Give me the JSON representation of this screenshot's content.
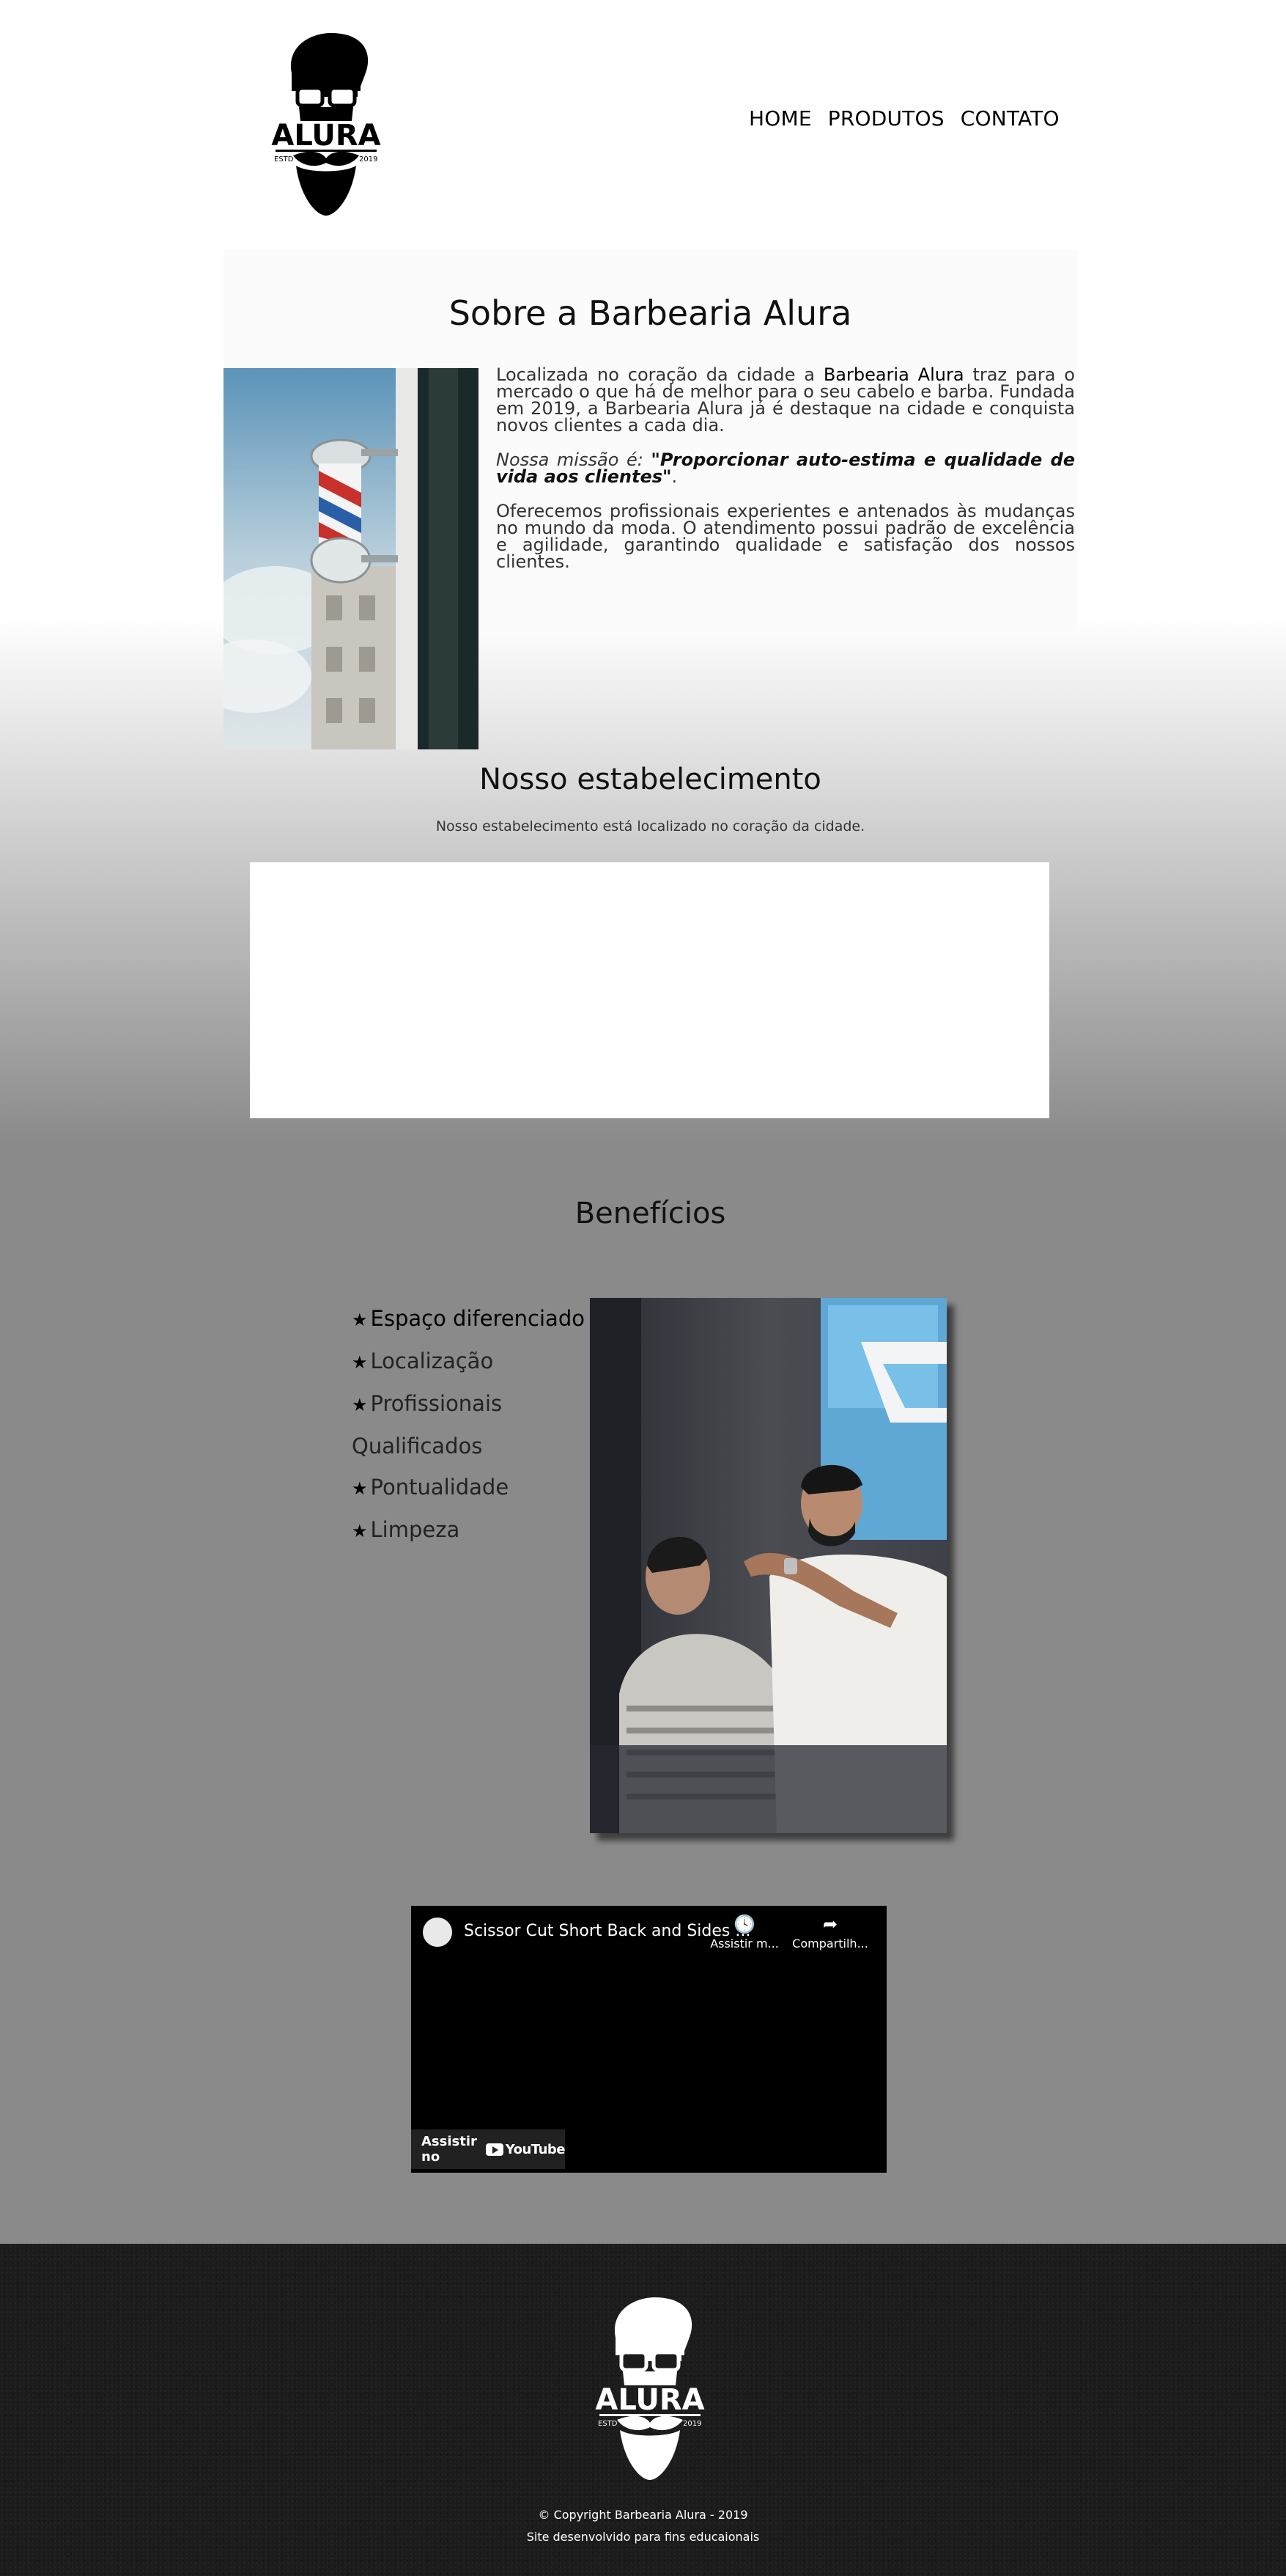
{
  "brand": {
    "name": "ALURA",
    "estd_left": "ESTD",
    "estd_right": "2019"
  },
  "nav": {
    "items": [
      "HOME",
      "PRODUTOS",
      "CONTATO"
    ]
  },
  "about": {
    "title": "Sobre a Barbearia Alura",
    "p1_before": "Localizada no coração da cidade a ",
    "p1_strong": "Barbearia Alura",
    "p1_after": " traz para o mercado o que há de melhor para o seu cabelo e barba. Fundada em 2019, a Barbearia Alura já é destaque na cidade e conquista novos clientes a cada dia.",
    "mission_label": "Nossa missão é: ",
    "mission_quote": "\"Proporcionar auto-estima e qualidade de vida aos clientes\"",
    "mission_end": ".",
    "p3": "Oferecemos profissionais experientes e antenados às mudanças no mundo da moda. O atendimento possui padrão de excelência e agilidade, garantindo qualidade e satisfação dos nossos clientes."
  },
  "establishment": {
    "title": "Nosso estabelecimento",
    "description": "Nosso estabelecimento está localizado no coração da cidade."
  },
  "benefits": {
    "title": "Benefícios",
    "items": [
      "Espaço diferenciado",
      "Localização",
      "Profissionais",
      "Qualificados",
      "Pontualidade",
      "Limpeza"
    ]
  },
  "video": {
    "title": "Scissor Cut Short Back and Sides ...",
    "watch_later": "Assistir m...",
    "share": "Compartilh...",
    "watch_on": "Assistir no",
    "youtube": "YouTube"
  },
  "footer": {
    "copyright": "© Copyright Barbearia Alura - 2019",
    "note": "Site desenvolvido para fins educaionais"
  }
}
